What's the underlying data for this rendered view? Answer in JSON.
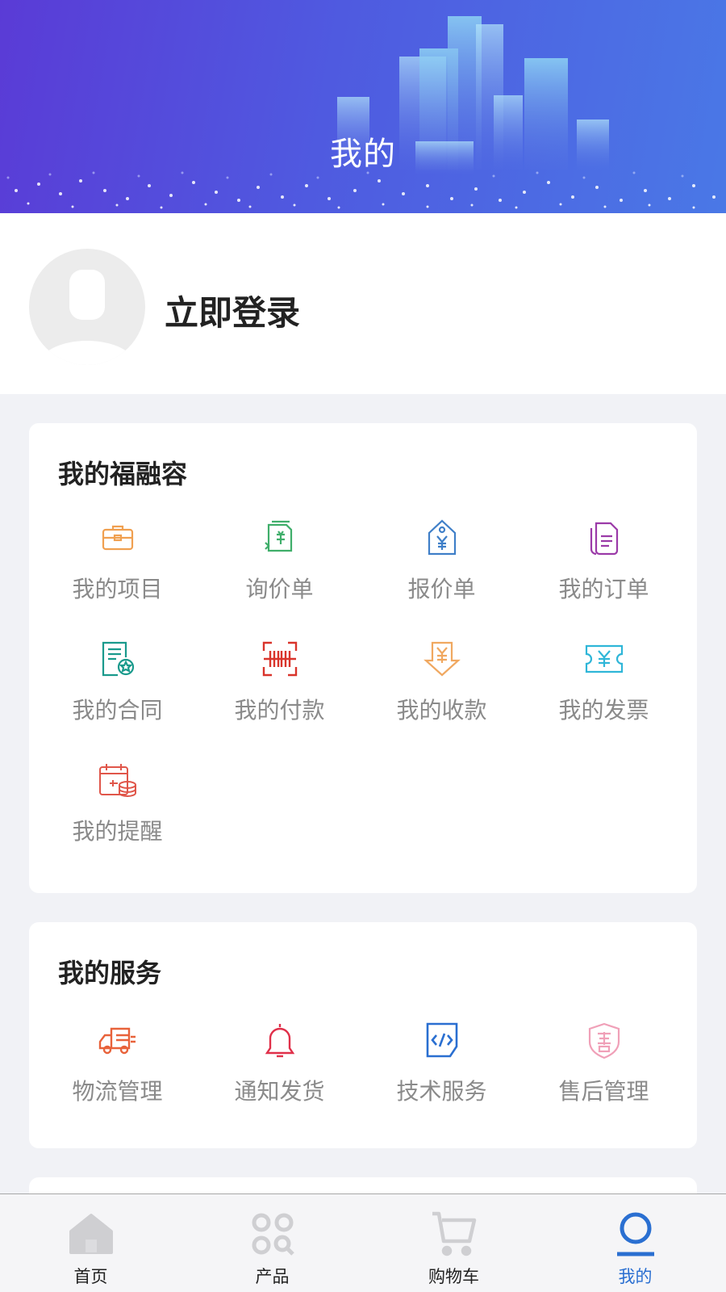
{
  "header": {
    "title": "我的"
  },
  "profile": {
    "login_label": "立即登录"
  },
  "fin_section": {
    "title": "我的福融容",
    "items": [
      {
        "label": "我的项目",
        "icon": "briefcase-icon",
        "color": "#f0a050"
      },
      {
        "label": "询价单",
        "icon": "inquiry-doc-icon",
        "color": "#3fae6a"
      },
      {
        "label": "报价单",
        "icon": "price-tag-icon",
        "color": "#3f7fc8"
      },
      {
        "label": "我的订单",
        "icon": "order-doc-icon",
        "color": "#9b3aa8"
      },
      {
        "label": "我的合同",
        "icon": "contract-icon",
        "color": "#1a9a8c"
      },
      {
        "label": "我的付款",
        "icon": "barcode-scan-icon",
        "color": "#d9342b"
      },
      {
        "label": "我的收款",
        "icon": "yuan-receive-icon",
        "color": "#f0a860"
      },
      {
        "label": "我的发票",
        "icon": "invoice-ticket-icon",
        "color": "#2fb6d8"
      },
      {
        "label": "我的提醒",
        "icon": "calendar-coins-icon",
        "color": "#e0564a"
      }
    ]
  },
  "service_section": {
    "title": "我的服务",
    "items": [
      {
        "label": "物流管理",
        "icon": "truck-icon",
        "color": "#e8623a"
      },
      {
        "label": "通知发货",
        "icon": "bell-icon",
        "color": "#e0304a"
      },
      {
        "label": "技术服务",
        "icon": "code-doc-icon",
        "color": "#2a6fd1"
      },
      {
        "label": "售后管理",
        "icon": "after-sale-shield-icon",
        "color": "#f0a0b8"
      }
    ]
  },
  "tabbar": {
    "items": [
      {
        "label": "首页",
        "icon": "home-icon",
        "active": false
      },
      {
        "label": "产品",
        "icon": "grid-apps-icon",
        "active": false
      },
      {
        "label": "购物车",
        "icon": "cart-icon",
        "active": false
      },
      {
        "label": "我的",
        "icon": "user-icon",
        "active": true
      }
    ],
    "active_color": "#2a6fd1"
  }
}
